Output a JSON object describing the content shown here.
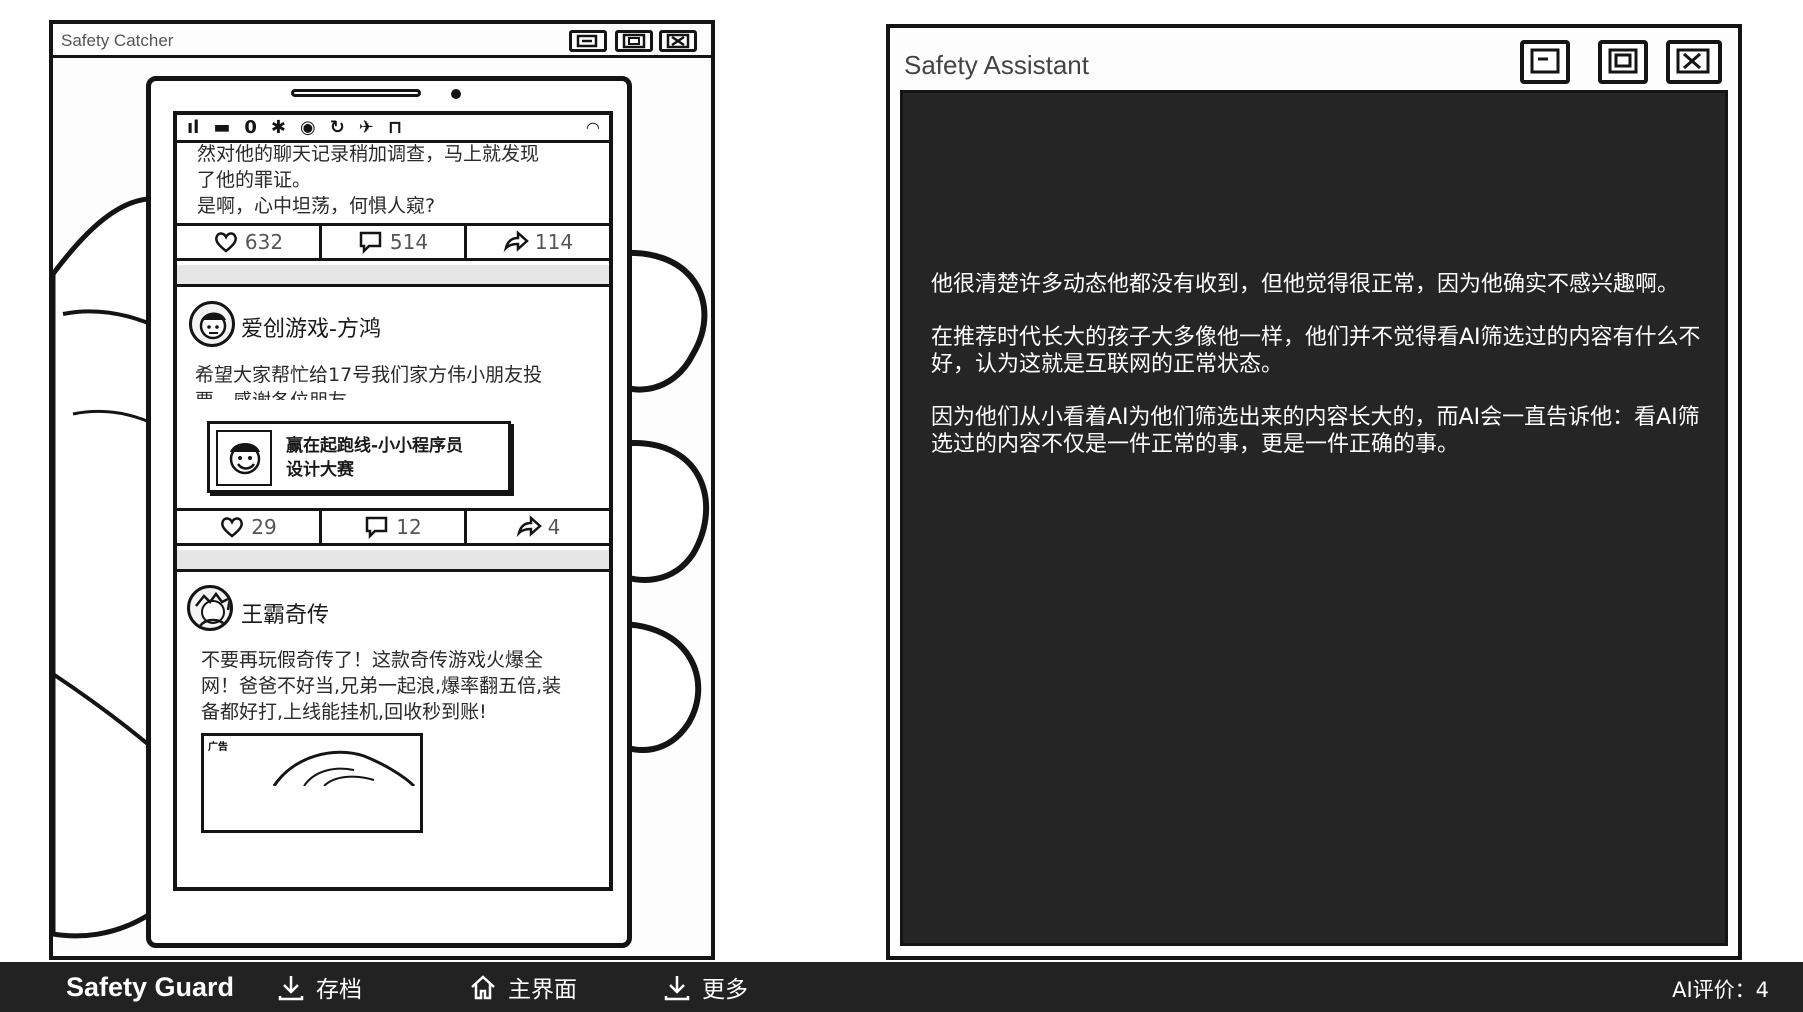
{
  "left_window": {
    "title": "Safety Catcher",
    "phone": {
      "post1": {
        "text_lines": [
          "然对他的聊天记录稍加调查，马上就发现",
          "了他的罪证。",
          "是啊，心中坦荡，何惧人窥?"
        ],
        "likes": "632",
        "comments": "514",
        "shares": "114"
      },
      "post2": {
        "author": "爱创游戏-方鸿",
        "text_lines": [
          "希望大家帮忙给17号我们家方伟小朋友投",
          "票，感谢各位朋友"
        ],
        "card_title_lines": [
          "赢在起跑线-小小程序员",
          "设计大赛"
        ],
        "likes": "29",
        "comments": "12",
        "shares": "4"
      },
      "post3": {
        "author": "王霸奇传",
        "text_lines": [
          "不要再玩假奇传了！这款奇传游戏火爆全",
          "网！爸爸不好当,兄弟一起浪,爆率翻五倍,装",
          "备都好打,上线能挂机,回收秒到账!"
        ],
        "ad_tag": "广告"
      }
    }
  },
  "right_window": {
    "title": "Safety Assistant",
    "paragraphs": [
      "他很清楚许多动态他都没有收到，但他觉得很正常，因为他确实不感兴趣啊。",
      "在推荐时代长大的孩子大多像他一样，他们并不觉得看AI筛选过的内容有什么不好，认为这就是互联网的正常状态。",
      "因为他们从小看着AI为他们筛选出来的内容长大的，而AI会一直告诉他：看AI筛选过的内容不仅是一件正常的事，更是一件正确的事。"
    ]
  },
  "bottom_bar": {
    "brand": "Safety Guard",
    "save_label": "存档",
    "home_label": "主界面",
    "more_label": "更多",
    "ai_score": "AI评价：4"
  },
  "colors": {
    "ink": "#141414",
    "content_bg": "#252525",
    "bar_bg": "#222222"
  }
}
